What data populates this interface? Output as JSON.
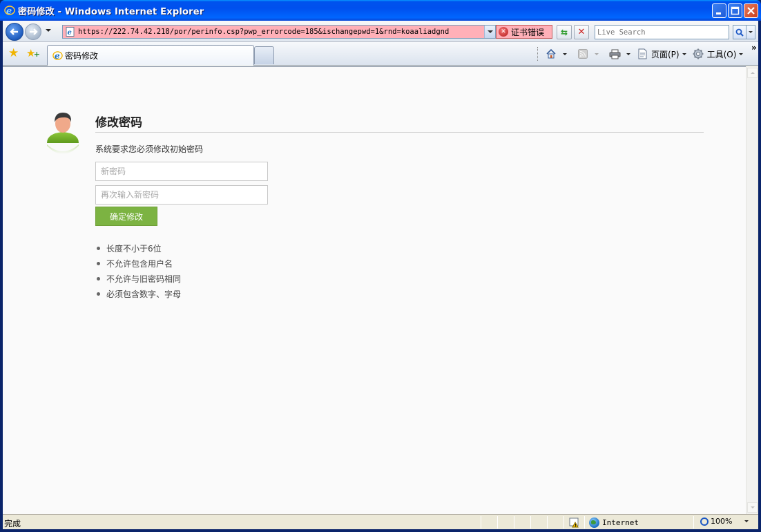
{
  "window": {
    "title": "密码修改 - Windows Internet Explorer"
  },
  "address_bar": {
    "url": "https://222.74.42.218/por/perinfo.csp?pwp_errorcode=185&ischangepwd=1&rnd=koaaliadgnd",
    "cert_error_label": "证书错误"
  },
  "search": {
    "placeholder": "Live Search"
  },
  "tabs": [
    {
      "label": "密码修改",
      "active": true
    }
  ],
  "toolbar": {
    "page_label": "页面(P)",
    "tools_label": "工具(O)"
  },
  "page": {
    "title": "修改密码",
    "hint": "系统要求您必须修改初始密码",
    "new_password_placeholder": "新密码",
    "confirm_password_placeholder": "再次输入新密码",
    "submit_label": "确定修改",
    "rules": [
      "长度不小于6位",
      "不允许包含用户名",
      "不允许与旧密码相同",
      "必须包含数字、字母"
    ]
  },
  "statusbar": {
    "status": "完成",
    "zone": "Internet",
    "zoom": "100%"
  },
  "colors": {
    "titlebar": "#0053ee",
    "submit_button": "#7cb342",
    "address_error_bg": "#ffb0b8"
  },
  "icons": {
    "ie": "ie-logo-icon",
    "back": "back-arrow-icon",
    "forward": "forward-arrow-icon",
    "refresh": "refresh-icon",
    "stop": "stop-icon",
    "search": "magnifier-icon",
    "favorites": "star-icon",
    "add_favorites": "add-favorite-icon",
    "home": "home-icon",
    "feeds": "rss-icon",
    "print": "printer-icon",
    "page": "page-icon",
    "tools": "gear-icon",
    "user": "user-avatar-icon",
    "security": "protected-mode-icon",
    "zone": "globe-icon",
    "zoom": "zoom-icon"
  }
}
